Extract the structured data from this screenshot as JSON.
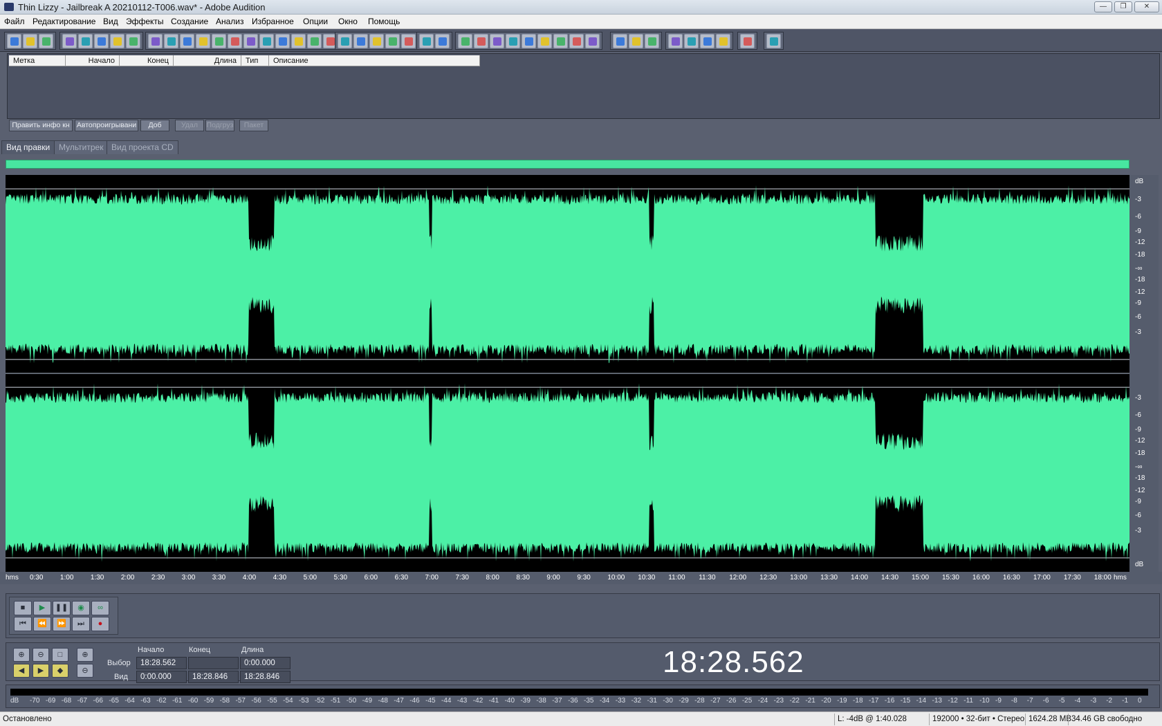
{
  "window": {
    "title": "Thin Lizzy - Jailbreak  A 20210112-T006.wav* - Adobe Audition"
  },
  "menu": [
    "Файл",
    "Редактирование",
    "Вид",
    "Эффекты",
    "Создание",
    "Анализ",
    "Избранное",
    "Опции",
    "Окно",
    "Помощь"
  ],
  "markers": {
    "columns": [
      "Метка",
      "Начало",
      "Конец",
      "Длина",
      "Тип",
      "Описание"
    ],
    "buttons": [
      {
        "label": "Править инфо кн",
        "enabled": true
      },
      {
        "label": "Автопроигрывани",
        "enabled": true
      },
      {
        "label": "Доб",
        "enabled": true
      },
      {
        "label": "Удал",
        "enabled": false
      },
      {
        "label": "Подгруз",
        "enabled": false
      },
      {
        "label": "Пакет",
        "enabled": false
      }
    ]
  },
  "tabs": [
    {
      "label": "Вид правки",
      "active": true
    },
    {
      "label": "Мультитрек",
      "active": false
    },
    {
      "label": "Вид проекта CD",
      "active": false
    }
  ],
  "waveform": {
    "color": "#4cf0a6",
    "background": "#000000",
    "channels": 2,
    "quiet_segments_min_sec": [
      [
        240,
        265
      ],
      [
        418,
        421
      ],
      [
        635,
        640
      ],
      [
        858,
        905
      ]
    ],
    "db_labels": [
      "dB",
      "-3",
      "-6",
      "-9",
      "-12",
      "-18",
      "-∞",
      "-18",
      "-12",
      "-9",
      "-6",
      "-3"
    ],
    "db_footer": "dB"
  },
  "time_ruler": {
    "start_label": "hms",
    "ticks": [
      "0:30",
      "1:00",
      "1:30",
      "2:00",
      "2:30",
      "3:00",
      "3:30",
      "4:00",
      "4:30",
      "5:00",
      "5:30",
      "6:00",
      "6:30",
      "7:00",
      "7:30",
      "8:00",
      "8:30",
      "9:00",
      "9:30",
      "10:00",
      "10:30",
      "11:00",
      "11:30",
      "12:00",
      "12:30",
      "13:00",
      "13:30",
      "14:00",
      "14:30",
      "15:00",
      "15:30",
      "16:00",
      "16:30",
      "17:00",
      "17:30",
      "18:00"
    ],
    "end_label": "hms"
  },
  "selection": {
    "headers": [
      "Начало",
      "Конец",
      "Длина"
    ],
    "rows": [
      {
        "label": "Выбор",
        "start": "18:28.562",
        "end": "",
        "length": "0:00.000"
      },
      {
        "label": "Вид",
        "start": "0:00.000",
        "end": "18:28.846",
        "length": "18:28.846"
      }
    ]
  },
  "current_time": "18:28.562",
  "meter": {
    "unit": "dB",
    "labels": [
      "-70",
      "-69",
      "-68",
      "-67",
      "-66",
      "-65",
      "-64",
      "-63",
      "-62",
      "-61",
      "-60",
      "-59",
      "-58",
      "-57",
      "-56",
      "-55",
      "-54",
      "-53",
      "-52",
      "-51",
      "-50",
      "-49",
      "-48",
      "-47",
      "-46",
      "-45",
      "-44",
      "-43",
      "-42",
      "-41",
      "-40",
      "-39",
      "-38",
      "-37",
      "-36",
      "-35",
      "-34",
      "-33",
      "-32",
      "-31",
      "-30",
      "-29",
      "-28",
      "-27",
      "-26",
      "-25",
      "-24",
      "-23",
      "-22",
      "-21",
      "-20",
      "-19",
      "-18",
      "-17",
      "-16",
      "-15",
      "-14",
      "-13",
      "-12",
      "-11",
      "-10",
      "-9",
      "-8",
      "-7",
      "-6",
      "-5",
      "-4",
      "-3",
      "-2",
      "-1",
      "0"
    ]
  },
  "status": {
    "state": "Остановлено",
    "level": "L: -4dB @  1:40.028",
    "format": "192000 • 32-бит • Стерео",
    "size": "1624.28 MB",
    "free": "34.46 GB свободно"
  },
  "colors": {
    "accent": "#4cf0a6",
    "panel": "#545b6c",
    "toolbar": "#4f5566"
  },
  "toolbar_icons": [
    "waveform-icon",
    "multitrack-icon",
    "cd-icon",
    "new-file-icon",
    "open-icon",
    "save-icon",
    "save-as-icon",
    "save-all-icon",
    "undo-icon",
    "redo-icon",
    "repeat-icon",
    "copy-icon",
    "copy-new-icon",
    "cut-icon",
    "paste-icon",
    "paste-new-icon",
    "mix-paste-icon",
    "trim-icon",
    "spectral-icon",
    "envelope-icon",
    "freq-icon",
    "pan-icon",
    "mono-icon",
    "cursor-icon",
    "selection-icon",
    "cue-icon",
    "marker-icon",
    "loop-icon",
    "play-icon",
    "zoom-icon",
    "time-icon",
    "grid-icon",
    "info-icon",
    "settings-icon",
    "effects-icon",
    "help-icon",
    "eq-icon",
    "noise-icon",
    "filter-icon",
    "amplify-icon",
    "analyze-icon",
    "stats-icon"
  ]
}
